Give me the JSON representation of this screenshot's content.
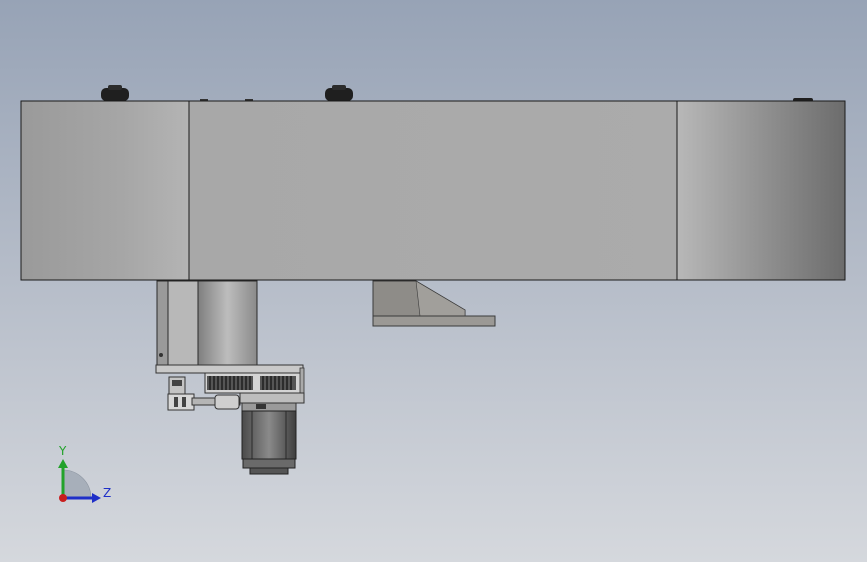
{
  "scene": {
    "view": "side-view",
    "background_top": "#97a3b6",
    "background_bottom": "#d5d8dd",
    "part_colors": {
      "beam": "#aaaaaa",
      "edge": "#1a1a1a",
      "knob": "#1e1e1e",
      "bracket": "#8c8a86"
    }
  },
  "triad": {
    "y_label": "Y",
    "z_label": "Z",
    "y_color": "#22a22a",
    "z_color": "#1e2fc8",
    "x_color": "#c81e1e"
  }
}
